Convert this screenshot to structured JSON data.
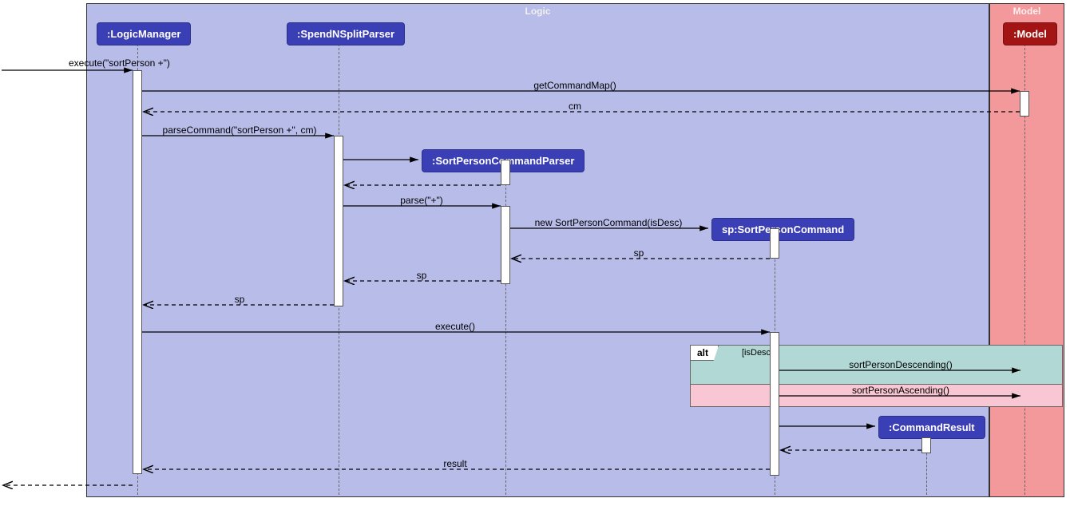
{
  "containers": {
    "logic": {
      "title": "Logic",
      "fill": "#b8bce9",
      "titleColor": "#f1eff0"
    },
    "model": {
      "title": "Model",
      "fill": "#f3999b",
      "titleColor": "#f7e0e0"
    }
  },
  "participants": {
    "logicManager": {
      "label": ":LogicManager"
    },
    "spendNSplitParser": {
      "label": ":SpendNSplitParser"
    },
    "sortPersonParser": {
      "label": ":SortPersonCommandParser"
    },
    "sortPersonCommand": {
      "label": "sp:SortPersonCommand"
    },
    "commandResult": {
      "label": ":CommandResult"
    },
    "model": {
      "label": ":Model"
    }
  },
  "messages": {
    "m1": "execute(\"sortPerson +\")",
    "m2": "getCommandMap()",
    "m3": "cm",
    "m4": "parseCommand(\"sortPerson +\", cm)",
    "m5_label_only": "",
    "m6": "parse(\"+\")",
    "m7": "new SortPersonCommand(isDesc)",
    "m8": "sp",
    "m9": "sp",
    "m10": "sp",
    "m11": "execute()",
    "m12": "sortPersonDescending()",
    "m13": "sortPersonAscending()",
    "m14_label_only": "",
    "m15": "result"
  },
  "fragment": {
    "label": "alt",
    "guard": "[isDesc]",
    "region1Fill": "#b2d8d6",
    "region2Fill": "#f9c6d4"
  }
}
